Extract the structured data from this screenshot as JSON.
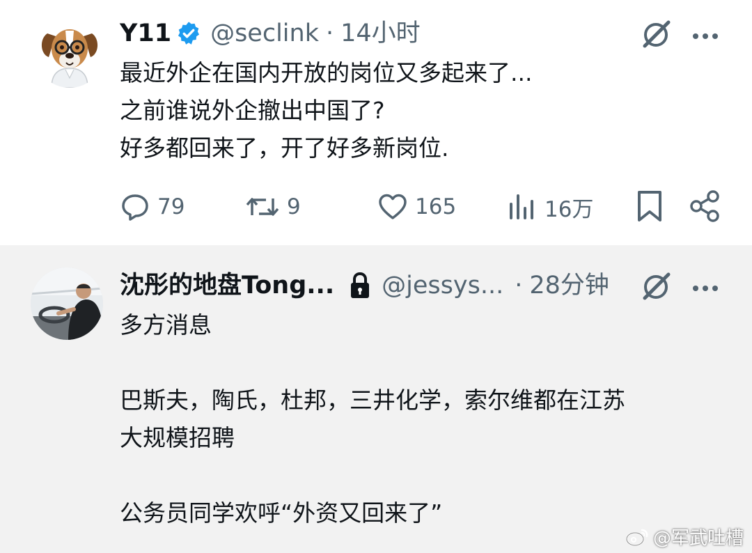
{
  "tweet": {
    "author_name": "Y11",
    "handle": "@seclink",
    "separator": "·",
    "time": "14小时",
    "lines": [
      "最近外企在国内开放的岗位又多起来了...",
      "之前谁说外企撤出中国了?",
      "好多都回来了，开了好多新岗位."
    ],
    "actions": {
      "replies": "79",
      "retweets": "9",
      "likes": "165",
      "views": "16万"
    }
  },
  "reply": {
    "author_name": "沈彤的地盘Tong...",
    "handle": "@jessys...",
    "separator": "·",
    "time": "28分钟",
    "lines": [
      "多方消息",
      "",
      "巴斯夫，陶氏，杜邦，三井化学，索尔维都在江苏",
      "大规模招聘",
      "",
      "公务员同学欢呼“外资又回来了”"
    ]
  },
  "watermark": {
    "text": "@军武吐槽"
  },
  "colors": {
    "verified": "#1d9bf0",
    "secondary_text": "#536471",
    "reply_background": "#f2f2f2"
  },
  "icons": [
    "verified-badge-icon",
    "lock-icon",
    "grok-icon",
    "more-icon",
    "reply-icon",
    "retweet-icon",
    "like-icon",
    "views-icon",
    "bookmark-icon",
    "share-icon",
    "weibo-icon"
  ]
}
